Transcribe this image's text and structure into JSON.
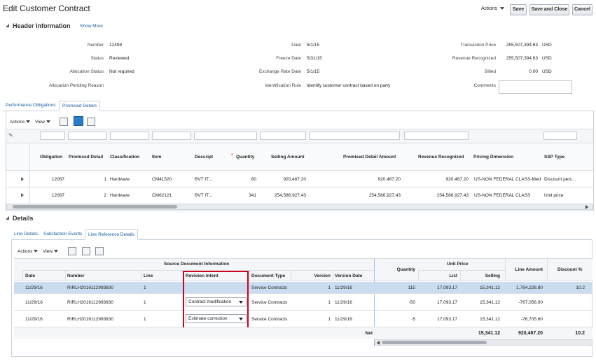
{
  "page": {
    "title": "Edit Customer Contract",
    "actions_label": "Actions",
    "save_label": "Save",
    "save_close_label": "Save and Close",
    "cancel_label": "Cancel"
  },
  "header": {
    "section_title": "Header Information",
    "show_more": "Show More",
    "fields": {
      "number_label": "Number",
      "number_value": "12498",
      "status_label": "Status",
      "status_value": "Reviewed",
      "allocation_status_label": "Allocation Status",
      "allocation_status_value": "Not required",
      "allocation_pending_label": "Allocation Pending Reason",
      "date_label": "Date",
      "date_value": "5/1/15",
      "freeze_date_label": "Freeze Date",
      "freeze_date_value": "5/31/15",
      "exchange_rate_date_label": "Exchange Rate Date",
      "exchange_rate_date_value": "5/1/15",
      "identification_rule_label": "Identification Rule",
      "identification_rule_value": "Identify customer contract based on party",
      "transaction_price_label": "Transaction Price",
      "transaction_price_value": "255,507,394.63",
      "transaction_price_currency": "USD",
      "revenue_recognized_label": "Revenue Recognized",
      "revenue_recognized_value": "255,507,394.63",
      "revenue_recognized_currency": "USD",
      "billed_label": "Billed",
      "billed_value": "0.00",
      "billed_currency": "USD",
      "comments_label": "Comments"
    }
  },
  "top_tabs": [
    "Performance Obligations",
    "Promised Details"
  ],
  "promised_toolbar": {
    "actions": "Actions",
    "view": "View"
  },
  "promised_table": {
    "columns": [
      "Obligation",
      "Promised Detail",
      "Classification",
      "Item",
      "Descript",
      "Quantity",
      "Selling Amount",
      "Promised Detail Amount",
      "Revenue Recognized",
      "Pricing Dimension",
      "SSP Type"
    ],
    "required_mark": "*",
    "rows": [
      [
        "12087",
        "1",
        "Hardware",
        "CM41520",
        "BVT IT...",
        "60",
        "920,467.20",
        "920,467.20",
        "920,467.20",
        "US-NON FEDERAL CLASS-Med",
        "Discount perc..."
      ],
      [
        "12087",
        "2",
        "Hardware",
        "CM62121",
        "BVT IT...",
        "341",
        "254,586,927.43",
        "254,586,927.43",
        "254,586,927.43",
        "US-NON FEDERAL CLASS",
        "Unit price"
      ]
    ]
  },
  "details": {
    "section_title": "Details",
    "tabs": [
      "Line Details",
      "Satisfaction Events",
      "Line Reference Details"
    ],
    "toolbar": {
      "actions": "Actions",
      "view": "View"
    },
    "group_header": "Source Document Information",
    "unit_price_header": "Unit Price",
    "columns": [
      "Date",
      "Number",
      "Line",
      "Revision Intent",
      "Document Type",
      "Version",
      "Version Date",
      "Quantity",
      "List",
      "Selling",
      "Line Amount",
      "Discount %"
    ],
    "rows": [
      {
        "date": "11/29/16",
        "number": "RIRLH2016112993830",
        "line": "1",
        "intent": "",
        "doc_type": "Service Contracts",
        "version": "1",
        "version_date": "11/29/16",
        "quantity": "115",
        "list": "17,093.17",
        "selling": "15,341.12",
        "line_amount": "1,764,228.80",
        "discount": "10.2"
      },
      {
        "date": "11/29/16",
        "number": "RIRLH2016112993830",
        "line": "1",
        "intent": "Contract modification",
        "doc_type": "Service Contracts",
        "version": "1",
        "version_date": "11/29/16",
        "quantity": "-50",
        "list": "17,093.17",
        "selling": "15,341.12",
        "line_amount": "-767,056.00",
        "discount": ""
      },
      {
        "date": "11/29/16",
        "number": "RIRLH2016112993830",
        "line": "1",
        "intent": "Estimate correction",
        "doc_type": "Service Contracts",
        "version": "1",
        "version_date": "11/29/16",
        "quantity": "-5",
        "list": "17,093.17",
        "selling": "15,341.12",
        "line_amount": "-76,705.60",
        "discount": ""
      }
    ],
    "footer": {
      "net_label": "Net",
      "selling": "15,341.12",
      "line_amount": "920,467.20",
      "discount": "10.2"
    }
  },
  "colors": {
    "link": "#145c9e",
    "highlight_box": "#d0021b",
    "selected_row": "#c9dcf0"
  }
}
